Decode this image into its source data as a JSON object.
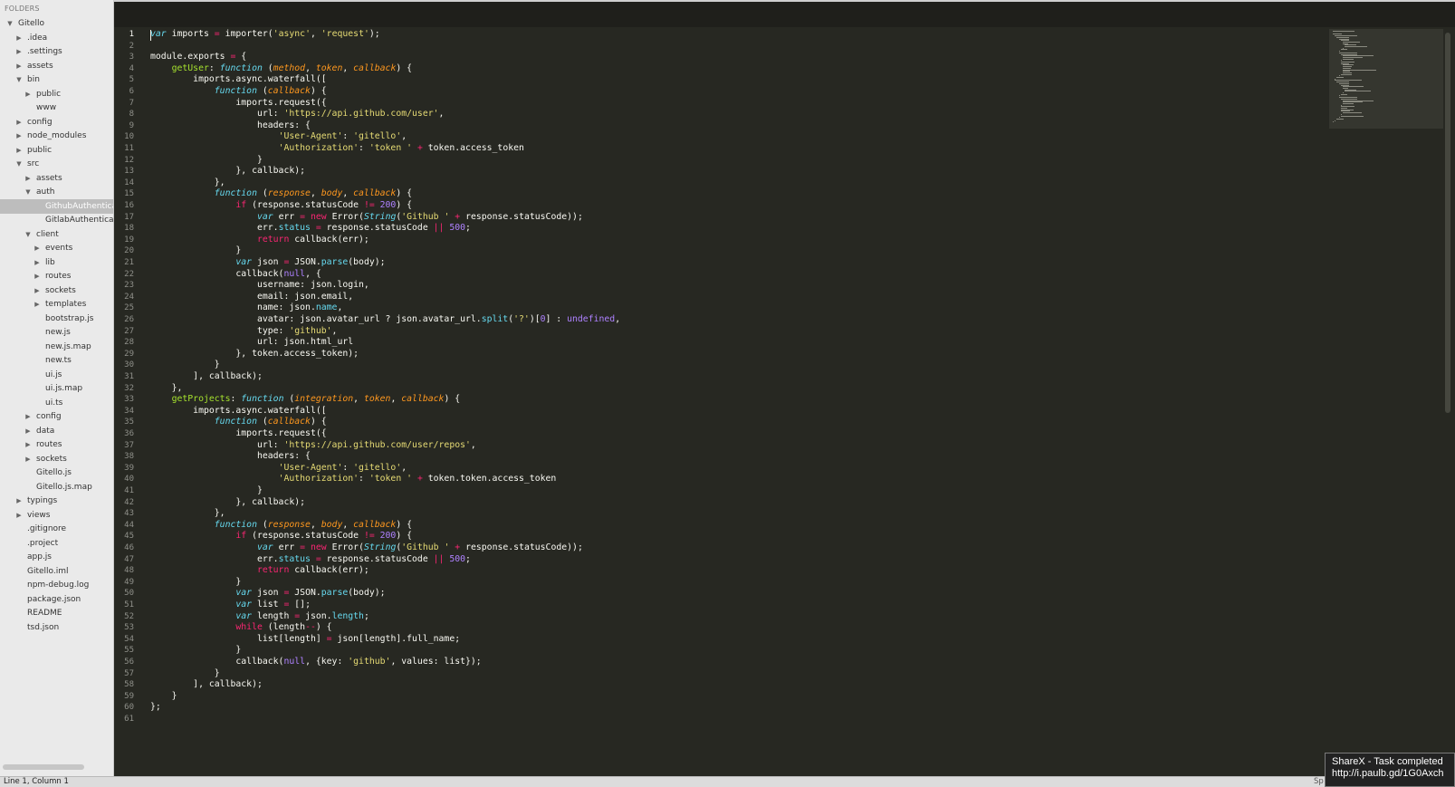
{
  "sidebar": {
    "header": "FOLDERS",
    "tree": [
      {
        "label": "Gitello",
        "depth": 0,
        "arrow": "down"
      },
      {
        "label": ".idea",
        "depth": 1,
        "arrow": "right"
      },
      {
        "label": ".settings",
        "depth": 1,
        "arrow": "right"
      },
      {
        "label": "assets",
        "depth": 1,
        "arrow": "right"
      },
      {
        "label": "bin",
        "depth": 1,
        "arrow": "down"
      },
      {
        "label": "public",
        "depth": 2,
        "arrow": "right"
      },
      {
        "label": "www",
        "depth": 2,
        "arrow": ""
      },
      {
        "label": "config",
        "depth": 1,
        "arrow": "right"
      },
      {
        "label": "node_modules",
        "depth": 1,
        "arrow": "right"
      },
      {
        "label": "public",
        "depth": 1,
        "arrow": "right"
      },
      {
        "label": "src",
        "depth": 1,
        "arrow": "down"
      },
      {
        "label": "assets",
        "depth": 2,
        "arrow": "right"
      },
      {
        "label": "auth",
        "depth": 2,
        "arrow": "down"
      },
      {
        "label": "GithubAuthentica",
        "depth": 3,
        "arrow": "",
        "selected": true
      },
      {
        "label": "GitlabAuthentica",
        "depth": 3,
        "arrow": ""
      },
      {
        "label": "client",
        "depth": 2,
        "arrow": "down"
      },
      {
        "label": "events",
        "depth": 3,
        "arrow": "right"
      },
      {
        "label": "lib",
        "depth": 3,
        "arrow": "right"
      },
      {
        "label": "routes",
        "depth": 3,
        "arrow": "right"
      },
      {
        "label": "sockets",
        "depth": 3,
        "arrow": "right"
      },
      {
        "label": "templates",
        "depth": 3,
        "arrow": "right"
      },
      {
        "label": "bootstrap.js",
        "depth": 3,
        "arrow": ""
      },
      {
        "label": "new.js",
        "depth": 3,
        "arrow": ""
      },
      {
        "label": "new.js.map",
        "depth": 3,
        "arrow": ""
      },
      {
        "label": "new.ts",
        "depth": 3,
        "arrow": ""
      },
      {
        "label": "ui.js",
        "depth": 3,
        "arrow": ""
      },
      {
        "label": "ui.js.map",
        "depth": 3,
        "arrow": ""
      },
      {
        "label": "ui.ts",
        "depth": 3,
        "arrow": ""
      },
      {
        "label": "config",
        "depth": 2,
        "arrow": "right"
      },
      {
        "label": "data",
        "depth": 2,
        "arrow": "right"
      },
      {
        "label": "routes",
        "depth": 2,
        "arrow": "right"
      },
      {
        "label": "sockets",
        "depth": 2,
        "arrow": "right"
      },
      {
        "label": "Gitello.js",
        "depth": 2,
        "arrow": ""
      },
      {
        "label": "Gitello.js.map",
        "depth": 2,
        "arrow": ""
      },
      {
        "label": "typings",
        "depth": 1,
        "arrow": "right"
      },
      {
        "label": "views",
        "depth": 1,
        "arrow": "right"
      },
      {
        "label": ".gitignore",
        "depth": 1,
        "arrow": ""
      },
      {
        "label": ".project",
        "depth": 1,
        "arrow": ""
      },
      {
        "label": "app.js",
        "depth": 1,
        "arrow": ""
      },
      {
        "label": "Gitello.iml",
        "depth": 1,
        "arrow": ""
      },
      {
        "label": "npm-debug.log",
        "depth": 1,
        "arrow": ""
      },
      {
        "label": "package.json",
        "depth": 1,
        "arrow": ""
      },
      {
        "label": "README",
        "depth": 1,
        "arrow": ""
      },
      {
        "label": "tsd.json",
        "depth": 1,
        "arrow": ""
      }
    ]
  },
  "editor": {
    "current_line": 1,
    "lines": [
      [
        [
          "kw",
          "var"
        ],
        [
          "t",
          " imports "
        ],
        [
          "op",
          "="
        ],
        [
          "t",
          " importer("
        ],
        [
          "str",
          "'async'"
        ],
        [
          "t",
          ", "
        ],
        [
          "str",
          "'request'"
        ],
        [
          "t",
          ");"
        ]
      ],
      [],
      [
        [
          "t",
          "module.exports "
        ],
        [
          "op",
          "="
        ],
        [
          "t",
          " {"
        ]
      ],
      [
        [
          "t",
          "    "
        ],
        [
          "fn",
          "getUser"
        ],
        [
          "t",
          ": "
        ],
        [
          "kw",
          "function"
        ],
        [
          "t",
          " ("
        ],
        [
          "par",
          "method"
        ],
        [
          "t",
          ", "
        ],
        [
          "par",
          "token"
        ],
        [
          "t",
          ", "
        ],
        [
          "par",
          "callback"
        ],
        [
          "t",
          ") {"
        ]
      ],
      [
        [
          "t",
          "        imports.async.waterfall(["
        ]
      ],
      [
        [
          "t",
          "            "
        ],
        [
          "kw",
          "function"
        ],
        [
          "t",
          " ("
        ],
        [
          "par",
          "callback"
        ],
        [
          "t",
          ") {"
        ]
      ],
      [
        [
          "t",
          "                imports.request({"
        ]
      ],
      [
        [
          "t",
          "                    url: "
        ],
        [
          "str",
          "'https://api.github.com/user'"
        ],
        [
          "t",
          ","
        ]
      ],
      [
        [
          "t",
          "                    headers: {"
        ]
      ],
      [
        [
          "t",
          "                        "
        ],
        [
          "str",
          "'User-Agent'"
        ],
        [
          "t",
          ": "
        ],
        [
          "str",
          "'gitello'"
        ],
        [
          "t",
          ","
        ]
      ],
      [
        [
          "t",
          "                        "
        ],
        [
          "str",
          "'Authorization'"
        ],
        [
          "t",
          ": "
        ],
        [
          "str",
          "'token '"
        ],
        [
          "t",
          " "
        ],
        [
          "op",
          "+"
        ],
        [
          "t",
          " token.access_token"
        ]
      ],
      [
        [
          "t",
          "                    }"
        ]
      ],
      [
        [
          "t",
          "                }, callback);"
        ]
      ],
      [
        [
          "t",
          "            },"
        ]
      ],
      [
        [
          "t",
          "            "
        ],
        [
          "kw",
          "function"
        ],
        [
          "t",
          " ("
        ],
        [
          "par",
          "response"
        ],
        [
          "t",
          ", "
        ],
        [
          "par",
          "body"
        ],
        [
          "t",
          ", "
        ],
        [
          "par",
          "callback"
        ],
        [
          "t",
          ") {"
        ]
      ],
      [
        [
          "t",
          "                "
        ],
        [
          "op",
          "if"
        ],
        [
          "t",
          " (response.statusCode "
        ],
        [
          "op",
          "!="
        ],
        [
          "t",
          " "
        ],
        [
          "num",
          "200"
        ],
        [
          "t",
          ") {"
        ]
      ],
      [
        [
          "t",
          "                    "
        ],
        [
          "kw",
          "var"
        ],
        [
          "t",
          " err "
        ],
        [
          "op",
          "="
        ],
        [
          "t",
          " "
        ],
        [
          "op",
          "new"
        ],
        [
          "t",
          " Error("
        ],
        [
          "cls",
          "String"
        ],
        [
          "t",
          "("
        ],
        [
          "str",
          "'Github '"
        ],
        [
          "t",
          " "
        ],
        [
          "op",
          "+"
        ],
        [
          "t",
          " response.statusCode));"
        ]
      ],
      [
        [
          "t",
          "                    err."
        ],
        [
          "prop",
          "status"
        ],
        [
          "t",
          " "
        ],
        [
          "op",
          "="
        ],
        [
          "t",
          " response.statusCode "
        ],
        [
          "op",
          "||"
        ],
        [
          "t",
          " "
        ],
        [
          "num",
          "500"
        ],
        [
          "t",
          ";"
        ]
      ],
      [
        [
          "t",
          "                    "
        ],
        [
          "op",
          "return"
        ],
        [
          "t",
          " callback(err);"
        ]
      ],
      [
        [
          "t",
          "                }"
        ]
      ],
      [
        [
          "t",
          "                "
        ],
        [
          "kw",
          "var"
        ],
        [
          "t",
          " json "
        ],
        [
          "op",
          "="
        ],
        [
          "t",
          " JSON."
        ],
        [
          "prop",
          "parse"
        ],
        [
          "t",
          "(body);"
        ]
      ],
      [
        [
          "t",
          "                callback("
        ],
        [
          "con",
          "null"
        ],
        [
          "t",
          ", {"
        ]
      ],
      [
        [
          "t",
          "                    username: json.login,"
        ]
      ],
      [
        [
          "t",
          "                    email: json.email,"
        ]
      ],
      [
        [
          "t",
          "                    name: json."
        ],
        [
          "prop",
          "name"
        ],
        [
          "t",
          ","
        ]
      ],
      [
        [
          "t",
          "                    avatar: json.avatar_url ? json.avatar_url."
        ],
        [
          "prop",
          "split"
        ],
        [
          "t",
          "("
        ],
        [
          "str",
          "'?'"
        ],
        [
          "t",
          ")["
        ],
        [
          "num",
          "0"
        ],
        [
          "t",
          "] : "
        ],
        [
          "con",
          "undefined"
        ],
        [
          "t",
          ","
        ]
      ],
      [
        [
          "t",
          "                    type: "
        ],
        [
          "str",
          "'github'"
        ],
        [
          "t",
          ","
        ]
      ],
      [
        [
          "t",
          "                    url: json.html_url"
        ]
      ],
      [
        [
          "t",
          "                }, token.access_token);"
        ]
      ],
      [
        [
          "t",
          "            }"
        ]
      ],
      [
        [
          "t",
          "        ], callback);"
        ]
      ],
      [
        [
          "t",
          "    },"
        ]
      ],
      [
        [
          "t",
          "    "
        ],
        [
          "fn",
          "getProjects"
        ],
        [
          "t",
          ": "
        ],
        [
          "kw",
          "function"
        ],
        [
          "t",
          " ("
        ],
        [
          "par",
          "integration"
        ],
        [
          "t",
          ", "
        ],
        [
          "par",
          "token"
        ],
        [
          "t",
          ", "
        ],
        [
          "par",
          "callback"
        ],
        [
          "t",
          ") {"
        ]
      ],
      [
        [
          "t",
          "        imports.async.waterfall(["
        ]
      ],
      [
        [
          "t",
          "            "
        ],
        [
          "kw",
          "function"
        ],
        [
          "t",
          " ("
        ],
        [
          "par",
          "callback"
        ],
        [
          "t",
          ") {"
        ]
      ],
      [
        [
          "t",
          "                imports.request({"
        ]
      ],
      [
        [
          "t",
          "                    url: "
        ],
        [
          "str",
          "'https://api.github.com/user/repos'"
        ],
        [
          "t",
          ","
        ]
      ],
      [
        [
          "t",
          "                    headers: {"
        ]
      ],
      [
        [
          "t",
          "                        "
        ],
        [
          "str",
          "'User-Agent'"
        ],
        [
          "t",
          ": "
        ],
        [
          "str",
          "'gitello'"
        ],
        [
          "t",
          ","
        ]
      ],
      [
        [
          "t",
          "                        "
        ],
        [
          "str",
          "'Authorization'"
        ],
        [
          "t",
          ": "
        ],
        [
          "str",
          "'token '"
        ],
        [
          "t",
          " "
        ],
        [
          "op",
          "+"
        ],
        [
          "t",
          " token.token.access_token"
        ]
      ],
      [
        [
          "t",
          "                    }"
        ]
      ],
      [
        [
          "t",
          "                }, callback);"
        ]
      ],
      [
        [
          "t",
          "            },"
        ]
      ],
      [
        [
          "t",
          "            "
        ],
        [
          "kw",
          "function"
        ],
        [
          "t",
          " ("
        ],
        [
          "par",
          "response"
        ],
        [
          "t",
          ", "
        ],
        [
          "par",
          "body"
        ],
        [
          "t",
          ", "
        ],
        [
          "par",
          "callback"
        ],
        [
          "t",
          ") {"
        ]
      ],
      [
        [
          "t",
          "                "
        ],
        [
          "op",
          "if"
        ],
        [
          "t",
          " (response.statusCode "
        ],
        [
          "op",
          "!="
        ],
        [
          "t",
          " "
        ],
        [
          "num",
          "200"
        ],
        [
          "t",
          ") {"
        ]
      ],
      [
        [
          "t",
          "                    "
        ],
        [
          "kw",
          "var"
        ],
        [
          "t",
          " err "
        ],
        [
          "op",
          "="
        ],
        [
          "t",
          " "
        ],
        [
          "op",
          "new"
        ],
        [
          "t",
          " Error("
        ],
        [
          "cls",
          "String"
        ],
        [
          "t",
          "("
        ],
        [
          "str",
          "'Github '"
        ],
        [
          "t",
          " "
        ],
        [
          "op",
          "+"
        ],
        [
          "t",
          " response.statusCode));"
        ]
      ],
      [
        [
          "t",
          "                    err."
        ],
        [
          "prop",
          "status"
        ],
        [
          "t",
          " "
        ],
        [
          "op",
          "="
        ],
        [
          "t",
          " response.statusCode "
        ],
        [
          "op",
          "||"
        ],
        [
          "t",
          " "
        ],
        [
          "num",
          "500"
        ],
        [
          "t",
          ";"
        ]
      ],
      [
        [
          "t",
          "                    "
        ],
        [
          "op",
          "return"
        ],
        [
          "t",
          " callback(err);"
        ]
      ],
      [
        [
          "t",
          "                }"
        ]
      ],
      [
        [
          "t",
          "                "
        ],
        [
          "kw",
          "var"
        ],
        [
          "t",
          " json "
        ],
        [
          "op",
          "="
        ],
        [
          "t",
          " JSON."
        ],
        [
          "prop",
          "parse"
        ],
        [
          "t",
          "(body);"
        ]
      ],
      [
        [
          "t",
          "                "
        ],
        [
          "kw",
          "var"
        ],
        [
          "t",
          " list "
        ],
        [
          "op",
          "="
        ],
        [
          "t",
          " [];"
        ]
      ],
      [
        [
          "t",
          "                "
        ],
        [
          "kw",
          "var"
        ],
        [
          "t",
          " length "
        ],
        [
          "op",
          "="
        ],
        [
          "t",
          " json."
        ],
        [
          "prop",
          "length"
        ],
        [
          "t",
          ";"
        ]
      ],
      [
        [
          "t",
          "                "
        ],
        [
          "op",
          "while"
        ],
        [
          "t",
          " (length"
        ],
        [
          "op",
          "--"
        ],
        [
          "t",
          ") {"
        ]
      ],
      [
        [
          "t",
          "                    list[length] "
        ],
        [
          "op",
          "="
        ],
        [
          "t",
          " json[length].full_name;"
        ]
      ],
      [
        [
          "t",
          "                }"
        ]
      ],
      [
        [
          "t",
          "                callback("
        ],
        [
          "con",
          "null"
        ],
        [
          "t",
          ", {key: "
        ],
        [
          "str",
          "'github'"
        ],
        [
          "t",
          ", values: list});"
        ]
      ],
      [
        [
          "t",
          "            }"
        ]
      ],
      [
        [
          "t",
          "        ], callback);"
        ]
      ],
      [
        [
          "t",
          "    }"
        ]
      ],
      [
        [
          "t",
          "};"
        ]
      ],
      []
    ]
  },
  "statusbar": {
    "position": "Line 1, Column 1",
    "right_text": "Sp"
  },
  "toast": {
    "title": "ShareX - Task completed",
    "url": "http://i.paulb.gd/1G0Axch"
  }
}
